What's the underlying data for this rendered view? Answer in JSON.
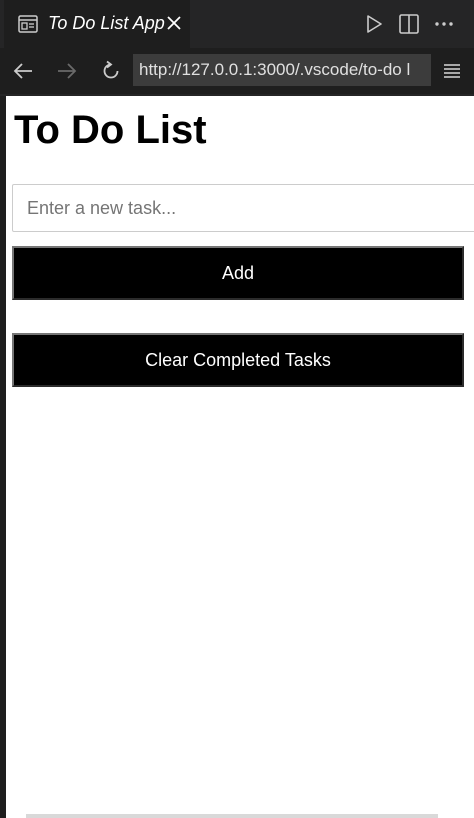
{
  "tab": {
    "title": "To Do List App",
    "icon": "browser-preview-icon"
  },
  "tab_actions": {
    "run_icon": "play-icon",
    "split_icon": "split-editor-icon",
    "more_icon": "more-actions-icon"
  },
  "nav": {
    "back_icon": "arrow-left-icon",
    "forward_icon": "arrow-right-icon",
    "reload_icon": "reload-icon",
    "url": "http://127.0.0.1:3000/.vscode/to-do l",
    "menu_icon": "hamburger-menu-icon"
  },
  "app": {
    "title": "To Do List",
    "input_placeholder": "Enter a new task...",
    "input_value": "",
    "add_label": "Add",
    "clear_label": "Clear Completed Tasks",
    "tasks": []
  },
  "colors": {
    "button_bg": "#000000",
    "button_text": "#ffffff",
    "page_bg": "#ffffff",
    "chrome_bg": "#1e1e1e"
  }
}
